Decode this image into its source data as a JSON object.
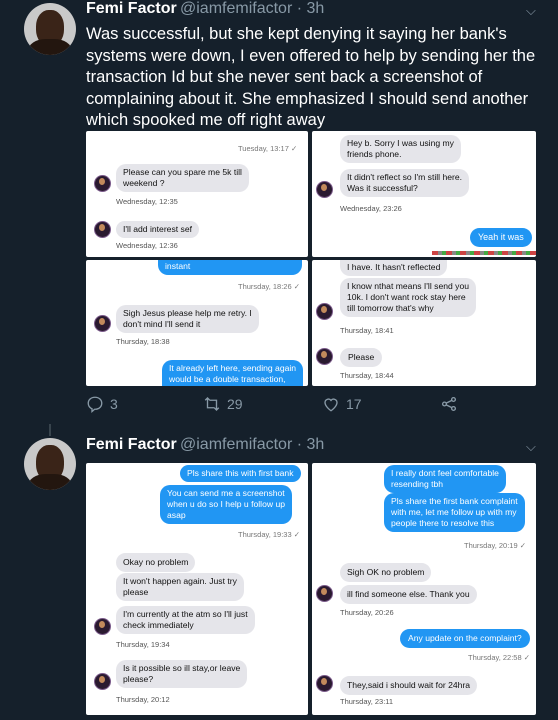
{
  "tweet1": {
    "name": "Femi Factor",
    "handle": "@iamfemifactor · 3h",
    "text": "Was successful,  but she kept denying it saying her bank's systems were down, I even offered to help by sending her the transaction Id but she never sent back a screenshot of complaining about it. She emphasized I should send another which spooked me off right away",
    "actions": {
      "replies": "3",
      "retweets": "29",
      "likes": "17"
    },
    "shots": {
      "a": {
        "ts_top": "Tuesday, 13:17 ✓",
        "m1": [
          "Please can you spare me 5k till",
          "weekend ?"
        ],
        "ts1": "Wednesday, 12:35",
        "m2": "I'll add interest sef",
        "ts2": "Wednesday, 12:36"
      },
      "b": {
        "m1": [
          "Hey b. Sorry I was using my",
          "friends phone."
        ],
        "m2": [
          "It didn't reflect so I'm still here.",
          "Was it successful?"
        ],
        "ts1": "Wednesday, 23:26",
        "m3": "Yeah it was"
      },
      "c": {
        "m0": "instant",
        "ts0": "Thursday, 18:26 ✓",
        "m1": [
          "Sigh Jesus please help me retry. I",
          "don't mind I'll send it"
        ],
        "ts1": "Thursday, 18:38",
        "m2": [
          "It already left here, sending again",
          "would be a double transaction,"
        ]
      },
      "d": {
        "m0": "I have. It hasn't reflected",
        "m1": [
          "I know nthat means I'll send you",
          "10k. I don't want rock stay here",
          "till tomorrow that's why"
        ],
        "ts1": "Thursday, 18:41",
        "m2": "Please",
        "ts2": "Thursday, 18:44"
      }
    }
  },
  "tweet2": {
    "name": "Femi Factor",
    "handle": "@iamfemifactor · 3h",
    "shots": {
      "e": {
        "m0": "Pls share this with first bank",
        "m1": [
          "You can send me a screenshot",
          "when u do so I help u follow up",
          "asap"
        ],
        "ts1": "Thursday, 19:33 ✓",
        "m2": "Okay no problem",
        "m3": [
          "It won't happen again. Just try",
          "please"
        ],
        "m4": [
          "I'm currently at the atm so I'll just",
          "check immediately"
        ],
        "ts2": "Thursday, 19:34",
        "m5": [
          "Is it possible so ill stay,or leave",
          "please?"
        ],
        "ts3": "Thursday, 20:12"
      },
      "f": {
        "m0": [
          "I really dont feel comfortable",
          "resending tbh"
        ],
        "m1": [
          "Pls share the first bank complaint",
          "with me, let me follow up with my",
          "people there to resolve this"
        ],
        "ts1": "Thursday, 20:19 ✓",
        "m2": "Sigh OK no problem",
        "m3": "ill find someone else. Thank you",
        "ts2": "Thursday, 20:26",
        "m4": "Any update on the complaint?",
        "ts3": "Thursday, 22:58 ✓",
        "m5": "They,said i should wait for 24hra",
        "ts4": "Thursday, 23:11"
      }
    }
  },
  "colors": {
    "bg": "#15202b",
    "muted": "#8899a6",
    "bubble_out": "#2196f3",
    "bubble_in": "#e5e5ea"
  }
}
